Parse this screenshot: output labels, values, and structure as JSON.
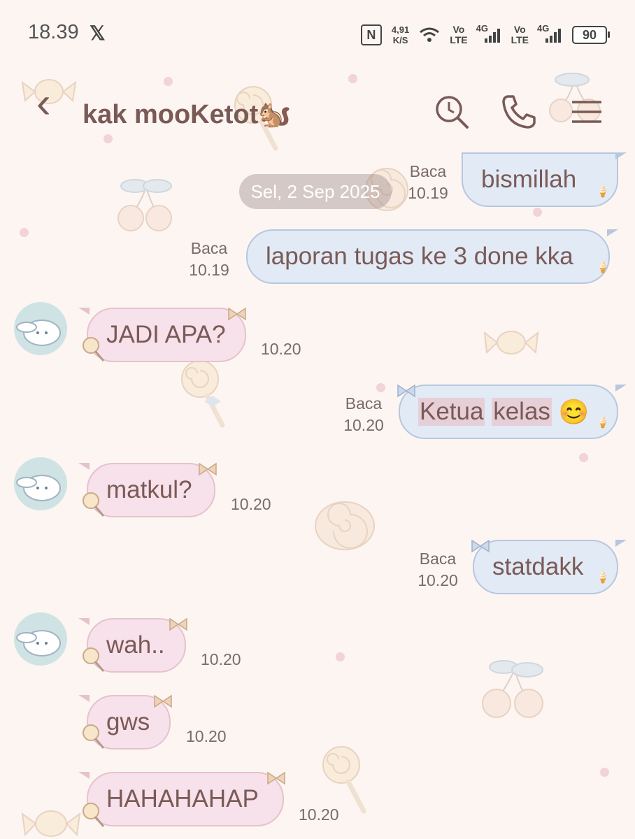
{
  "status_bar": {
    "time": "18.39",
    "x_logo": "𝕏",
    "nfc": "N",
    "net_speed_value": "4,91",
    "net_speed_unit": "K/S",
    "volte1_top": "Vo",
    "volte1_bottom": "LTE",
    "sig1_type": "4G",
    "volte2_top": "Vo",
    "volte2_bottom": "LTE",
    "sig2_type": "4G",
    "battery": "90"
  },
  "header": {
    "back": "‹",
    "title": "kak mooKetot🐿️"
  },
  "chat": {
    "date": "Sel, 2 Sep 2025",
    "messages": [
      {
        "side": "out",
        "text": "bismillah",
        "status": "Baca",
        "time": "10.19"
      },
      {
        "side": "out",
        "text": "laporan tugas ke 3 done kka",
        "status": "Baca",
        "time": "10.19"
      },
      {
        "side": "in",
        "text": "JADI APA?",
        "time": "10.20"
      },
      {
        "side": "out",
        "text_part1": "Ketua",
        "text_part2": "kelas",
        "emoji": "😊",
        "status": "Baca",
        "time": "10.20"
      },
      {
        "side": "in",
        "text": "matkul?",
        "time": "10.20"
      },
      {
        "side": "out",
        "text": "statdakk",
        "status": "Baca",
        "time": "10.20"
      },
      {
        "side": "in",
        "text": "wah..",
        "time": "10.20"
      },
      {
        "side": "in",
        "text": "gws",
        "time": "10.20"
      },
      {
        "side": "in",
        "text": "HAHAHAHAP",
        "time": "10.20"
      }
    ]
  },
  "colors": {
    "background": "#fcf5f2",
    "outgoing_bubble": "#e2eaf6",
    "incoming_bubble": "#f7e1ea",
    "text": "#7a5a56"
  }
}
